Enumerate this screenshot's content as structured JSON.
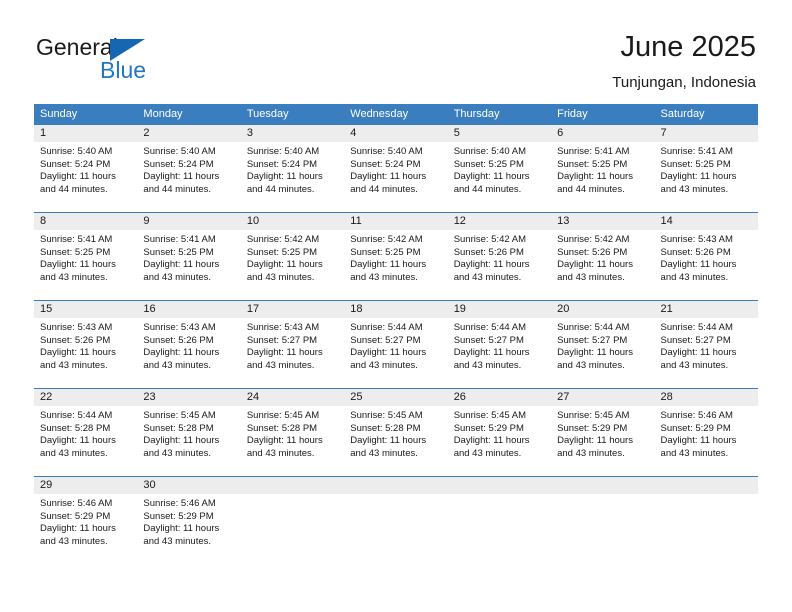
{
  "brand": {
    "word1": "General",
    "word2": "Blue",
    "triangle_color": "#1667b2",
    "blue_text_color": "#1f78c1"
  },
  "header": {
    "title": "June 2025",
    "subtitle": "Tunjungan, Indonesia"
  },
  "theme": {
    "header_bg": "#3b7ec0",
    "header_text": "#ffffff",
    "daynum_bg": "#ededed",
    "cell_bg": "#ffffff",
    "text": "#1a1a1a"
  },
  "weekdays": [
    "Sunday",
    "Monday",
    "Tuesday",
    "Wednesday",
    "Thursday",
    "Friday",
    "Saturday"
  ],
  "weeks": [
    [
      {
        "day": "1",
        "sunrise": "Sunrise: 5:40 AM",
        "sunset": "Sunset: 5:24 PM",
        "daylight1": "Daylight: 11 hours",
        "daylight2": "and 44 minutes."
      },
      {
        "day": "2",
        "sunrise": "Sunrise: 5:40 AM",
        "sunset": "Sunset: 5:24 PM",
        "daylight1": "Daylight: 11 hours",
        "daylight2": "and 44 minutes."
      },
      {
        "day": "3",
        "sunrise": "Sunrise: 5:40 AM",
        "sunset": "Sunset: 5:24 PM",
        "daylight1": "Daylight: 11 hours",
        "daylight2": "and 44 minutes."
      },
      {
        "day": "4",
        "sunrise": "Sunrise: 5:40 AM",
        "sunset": "Sunset: 5:24 PM",
        "daylight1": "Daylight: 11 hours",
        "daylight2": "and 44 minutes."
      },
      {
        "day": "5",
        "sunrise": "Sunrise: 5:40 AM",
        "sunset": "Sunset: 5:25 PM",
        "daylight1": "Daylight: 11 hours",
        "daylight2": "and 44 minutes."
      },
      {
        "day": "6",
        "sunrise": "Sunrise: 5:41 AM",
        "sunset": "Sunset: 5:25 PM",
        "daylight1": "Daylight: 11 hours",
        "daylight2": "and 44 minutes."
      },
      {
        "day": "7",
        "sunrise": "Sunrise: 5:41 AM",
        "sunset": "Sunset: 5:25 PM",
        "daylight1": "Daylight: 11 hours",
        "daylight2": "and 43 minutes."
      }
    ],
    [
      {
        "day": "8",
        "sunrise": "Sunrise: 5:41 AM",
        "sunset": "Sunset: 5:25 PM",
        "daylight1": "Daylight: 11 hours",
        "daylight2": "and 43 minutes."
      },
      {
        "day": "9",
        "sunrise": "Sunrise: 5:41 AM",
        "sunset": "Sunset: 5:25 PM",
        "daylight1": "Daylight: 11 hours",
        "daylight2": "and 43 minutes."
      },
      {
        "day": "10",
        "sunrise": "Sunrise: 5:42 AM",
        "sunset": "Sunset: 5:25 PM",
        "daylight1": "Daylight: 11 hours",
        "daylight2": "and 43 minutes."
      },
      {
        "day": "11",
        "sunrise": "Sunrise: 5:42 AM",
        "sunset": "Sunset: 5:25 PM",
        "daylight1": "Daylight: 11 hours",
        "daylight2": "and 43 minutes."
      },
      {
        "day": "12",
        "sunrise": "Sunrise: 5:42 AM",
        "sunset": "Sunset: 5:26 PM",
        "daylight1": "Daylight: 11 hours",
        "daylight2": "and 43 minutes."
      },
      {
        "day": "13",
        "sunrise": "Sunrise: 5:42 AM",
        "sunset": "Sunset: 5:26 PM",
        "daylight1": "Daylight: 11 hours",
        "daylight2": "and 43 minutes."
      },
      {
        "day": "14",
        "sunrise": "Sunrise: 5:43 AM",
        "sunset": "Sunset: 5:26 PM",
        "daylight1": "Daylight: 11 hours",
        "daylight2": "and 43 minutes."
      }
    ],
    [
      {
        "day": "15",
        "sunrise": "Sunrise: 5:43 AM",
        "sunset": "Sunset: 5:26 PM",
        "daylight1": "Daylight: 11 hours",
        "daylight2": "and 43 minutes."
      },
      {
        "day": "16",
        "sunrise": "Sunrise: 5:43 AM",
        "sunset": "Sunset: 5:26 PM",
        "daylight1": "Daylight: 11 hours",
        "daylight2": "and 43 minutes."
      },
      {
        "day": "17",
        "sunrise": "Sunrise: 5:43 AM",
        "sunset": "Sunset: 5:27 PM",
        "daylight1": "Daylight: 11 hours",
        "daylight2": "and 43 minutes."
      },
      {
        "day": "18",
        "sunrise": "Sunrise: 5:44 AM",
        "sunset": "Sunset: 5:27 PM",
        "daylight1": "Daylight: 11 hours",
        "daylight2": "and 43 minutes."
      },
      {
        "day": "19",
        "sunrise": "Sunrise: 5:44 AM",
        "sunset": "Sunset: 5:27 PM",
        "daylight1": "Daylight: 11 hours",
        "daylight2": "and 43 minutes."
      },
      {
        "day": "20",
        "sunrise": "Sunrise: 5:44 AM",
        "sunset": "Sunset: 5:27 PM",
        "daylight1": "Daylight: 11 hours",
        "daylight2": "and 43 minutes."
      },
      {
        "day": "21",
        "sunrise": "Sunrise: 5:44 AM",
        "sunset": "Sunset: 5:27 PM",
        "daylight1": "Daylight: 11 hours",
        "daylight2": "and 43 minutes."
      }
    ],
    [
      {
        "day": "22",
        "sunrise": "Sunrise: 5:44 AM",
        "sunset": "Sunset: 5:28 PM",
        "daylight1": "Daylight: 11 hours",
        "daylight2": "and 43 minutes."
      },
      {
        "day": "23",
        "sunrise": "Sunrise: 5:45 AM",
        "sunset": "Sunset: 5:28 PM",
        "daylight1": "Daylight: 11 hours",
        "daylight2": "and 43 minutes."
      },
      {
        "day": "24",
        "sunrise": "Sunrise: 5:45 AM",
        "sunset": "Sunset: 5:28 PM",
        "daylight1": "Daylight: 11 hours",
        "daylight2": "and 43 minutes."
      },
      {
        "day": "25",
        "sunrise": "Sunrise: 5:45 AM",
        "sunset": "Sunset: 5:28 PM",
        "daylight1": "Daylight: 11 hours",
        "daylight2": "and 43 minutes."
      },
      {
        "day": "26",
        "sunrise": "Sunrise: 5:45 AM",
        "sunset": "Sunset: 5:29 PM",
        "daylight1": "Daylight: 11 hours",
        "daylight2": "and 43 minutes."
      },
      {
        "day": "27",
        "sunrise": "Sunrise: 5:45 AM",
        "sunset": "Sunset: 5:29 PM",
        "daylight1": "Daylight: 11 hours",
        "daylight2": "and 43 minutes."
      },
      {
        "day": "28",
        "sunrise": "Sunrise: 5:46 AM",
        "sunset": "Sunset: 5:29 PM",
        "daylight1": "Daylight: 11 hours",
        "daylight2": "and 43 minutes."
      }
    ],
    [
      {
        "day": "29",
        "sunrise": "Sunrise: 5:46 AM",
        "sunset": "Sunset: 5:29 PM",
        "daylight1": "Daylight: 11 hours",
        "daylight2": "and 43 minutes."
      },
      {
        "day": "30",
        "sunrise": "Sunrise: 5:46 AM",
        "sunset": "Sunset: 5:29 PM",
        "daylight1": "Daylight: 11 hours",
        "daylight2": "and 43 minutes."
      },
      {
        "day": "",
        "sunrise": "",
        "sunset": "",
        "daylight1": "",
        "daylight2": ""
      },
      {
        "day": "",
        "sunrise": "",
        "sunset": "",
        "daylight1": "",
        "daylight2": ""
      },
      {
        "day": "",
        "sunrise": "",
        "sunset": "",
        "daylight1": "",
        "daylight2": ""
      },
      {
        "day": "",
        "sunrise": "",
        "sunset": "",
        "daylight1": "",
        "daylight2": ""
      },
      {
        "day": "",
        "sunrise": "",
        "sunset": "",
        "daylight1": "",
        "daylight2": ""
      }
    ]
  ]
}
